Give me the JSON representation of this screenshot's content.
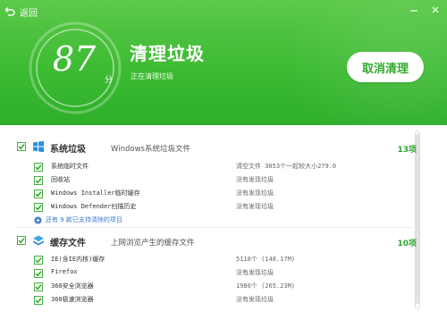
{
  "header": {
    "back_label": "返回",
    "score": "87",
    "score_unit": "分",
    "title": "清理垃圾",
    "subtitle": "正在清理垃圾",
    "cancel_label": "取消清理",
    "controls": [
      "minimize-icon",
      "close-icon"
    ]
  },
  "groups": [
    {
      "name": "系统垃圾",
      "desc": "Windows系统垃圾文件",
      "count": "13项",
      "icon": "windows-icon",
      "items": [
        {
          "name": "系统临时文件",
          "status": "清空文件 3053个一起较大小279.0"
        },
        {
          "name": "回收站",
          "status": "没有发现垃圾"
        },
        {
          "name": "Windows Installer临时缓存",
          "status": "没有发现垃圾"
        },
        {
          "name": "Windows Defender扫描历史",
          "status": "没有发现垃圾"
        }
      ],
      "expand_label": "还有 9 款已支持清除的项目"
    },
    {
      "name": "缓存文件",
      "desc": "上网浏览产生的缓存文件",
      "count": "10项",
      "icon": "cloud-cache-icon",
      "items": [
        {
          "name": "IE(含IE内核)缓存",
          "status": "5110个 (148.17M)"
        },
        {
          "name": "Firefox",
          "status": "没有发现垃圾"
        },
        {
          "name": "360安全浏览器",
          "status": "1980个 (265.23M)"
        },
        {
          "name": "360极速浏览器",
          "status": "没有发现垃圾"
        }
      ]
    }
  ],
  "colors": {
    "header_green": "#3dbb33",
    "accent_green": "#2aa52a",
    "link_blue": "#3a7bd5"
  }
}
